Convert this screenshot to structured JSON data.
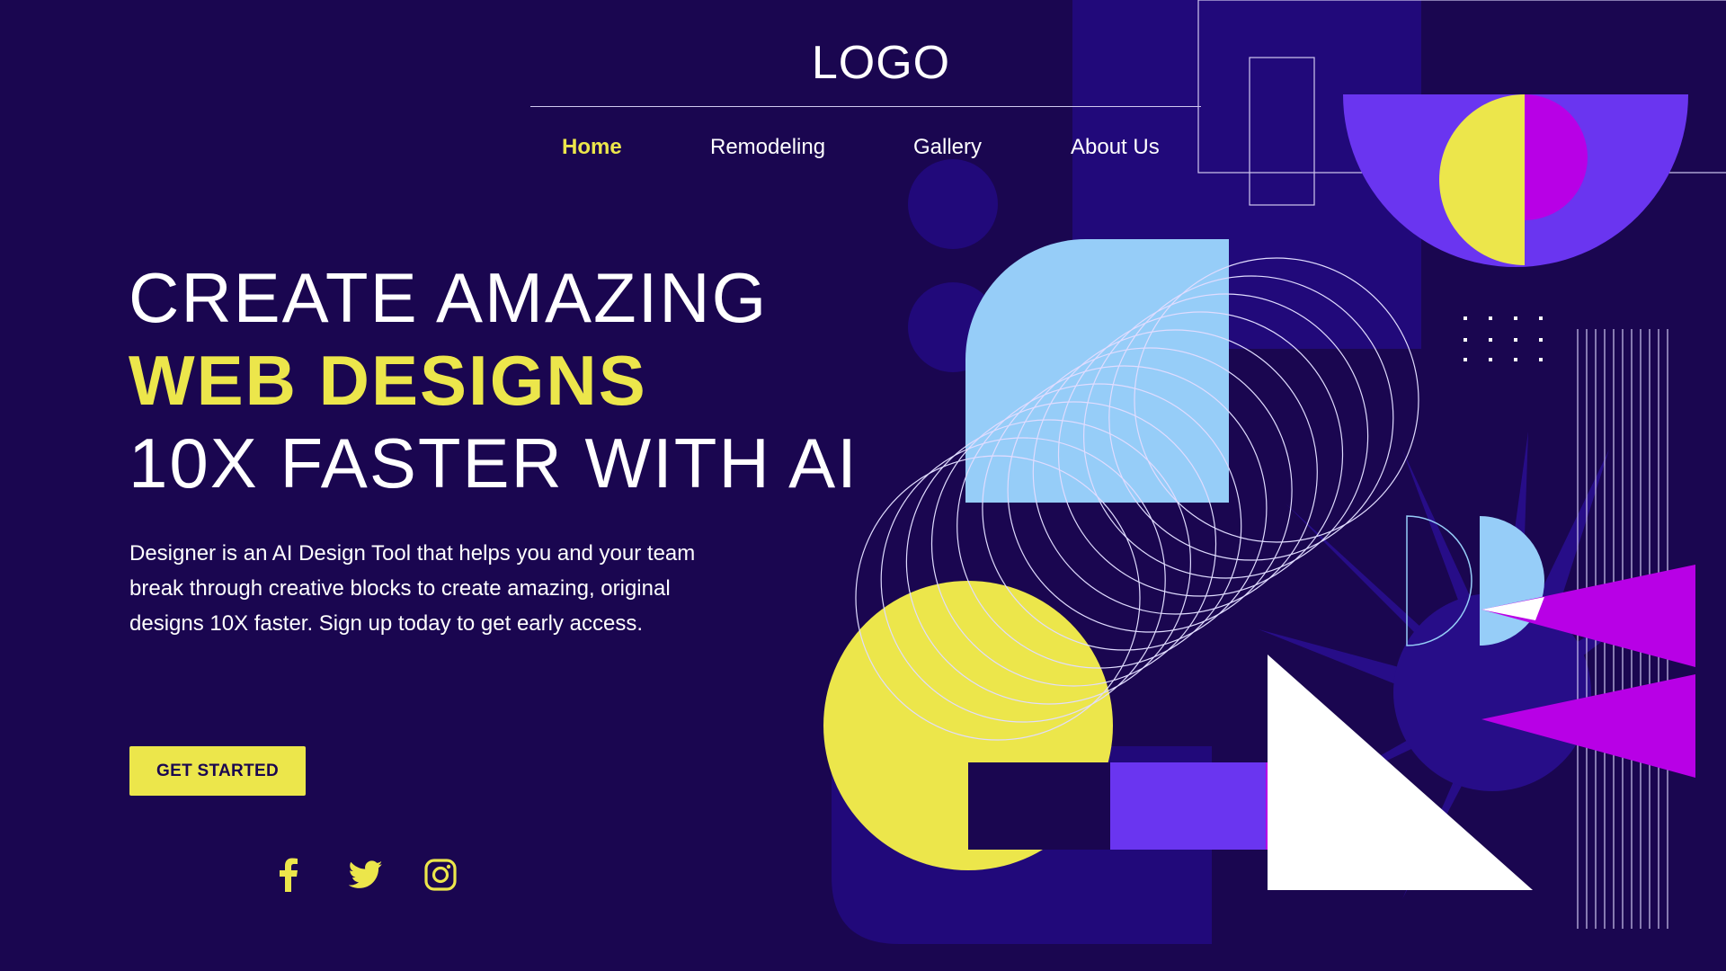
{
  "header": {
    "logo": "LOGO",
    "nav": [
      {
        "label": "Home",
        "active": true
      },
      {
        "label": "Remodeling"
      },
      {
        "label": "Gallery"
      },
      {
        "label": "About Us"
      }
    ]
  },
  "hero": {
    "line1": "CREATE AMAZING",
    "line2": "WEB DESIGNS",
    "line3": "10X FASTER WITH AI",
    "description": "Designer is an AI Design Tool that helps you and your team break through creative blocks to create amazing, original designs 10X faster. Sign up today to get early access.",
    "cta_label": "GET STARTED"
  },
  "social": [
    {
      "icon": "facebook-icon"
    },
    {
      "icon": "twitter-icon"
    },
    {
      "icon": "instagram-icon"
    }
  ],
  "colors": {
    "background": "#1a0650",
    "accent_yellow": "#ece64b",
    "light_blue": "#96cdf8",
    "violet": "#6a35f0",
    "magenta": "#b800e6",
    "deep_purple": "#21097a"
  }
}
